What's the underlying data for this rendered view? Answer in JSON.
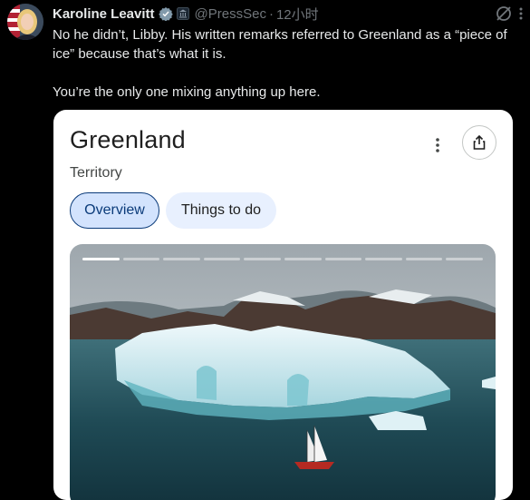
{
  "author": {
    "name": "Karoline Leavitt",
    "handle": "@PressSec",
    "separator": "·",
    "time": "12小时"
  },
  "tweet": {
    "paragraphs": [
      "No he didn’t, Libby. His written remarks referred to Greenland as a “piece of ice” because that’s what it is.",
      "You’re the only one mixing anything up here."
    ]
  },
  "card": {
    "title": "Greenland",
    "subtitle": "Territory",
    "tabs": [
      {
        "label": "Overview",
        "selected": true
      },
      {
        "label": "Things to do",
        "selected": false
      }
    ],
    "image_description_icon": "iceberg-photo",
    "slideshow": {
      "total": 10,
      "current": 1
    }
  },
  "icons": {
    "verified": "verified-badge-icon",
    "affiliation": "government-affiliation-icon",
    "grok": "grok-icon",
    "more": "more-icon",
    "share": "share-icon"
  },
  "colors": {
    "background": "#000000",
    "text": "#e7e9ea",
    "muted": "#71767b",
    "verified": "#1d9bf0",
    "chip_active": "#d3e3fd",
    "chip_border": "#0b3b7a"
  }
}
